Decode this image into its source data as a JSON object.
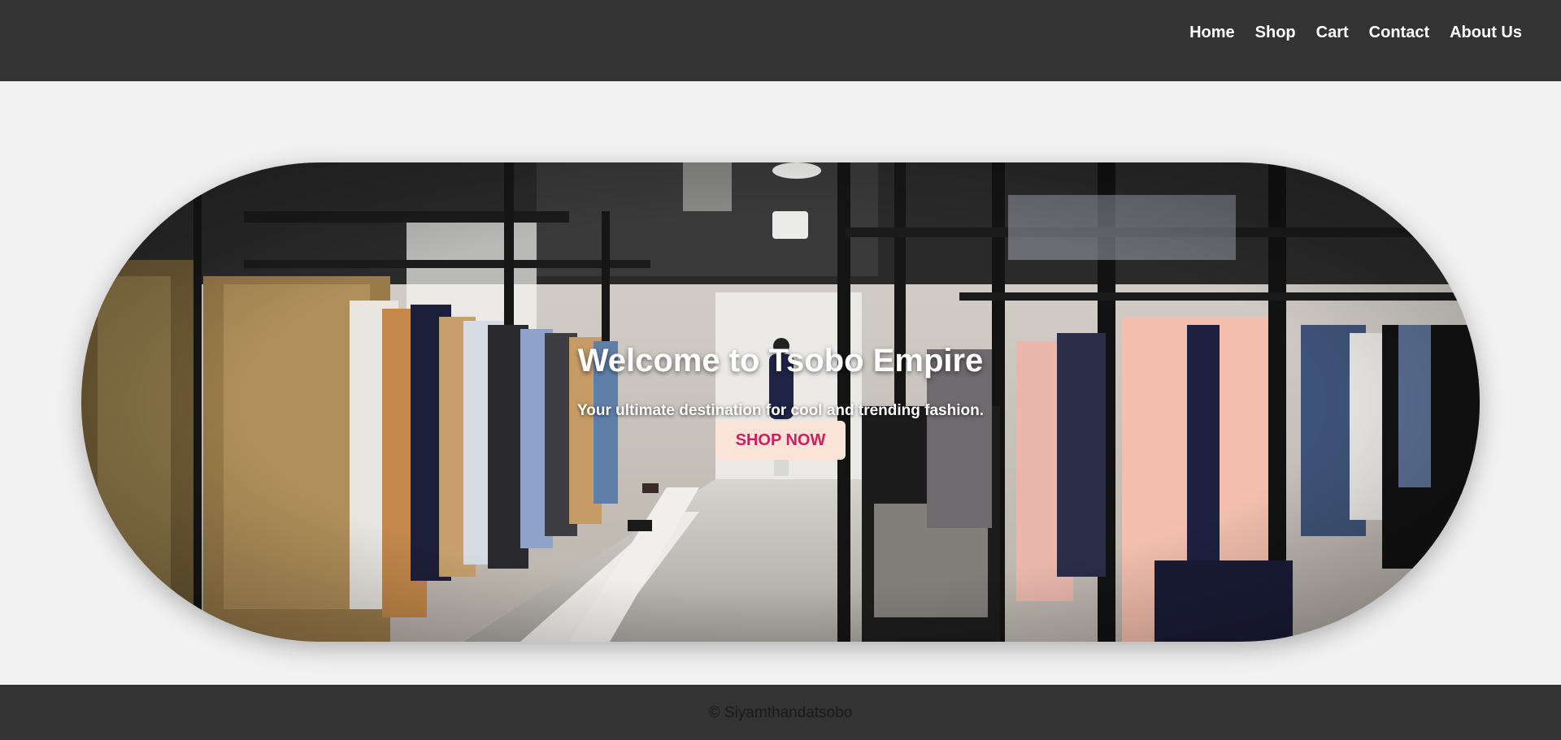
{
  "nav": {
    "items": [
      {
        "label": "Home"
      },
      {
        "label": "Shop"
      },
      {
        "label": "Cart"
      },
      {
        "label": "Contact"
      },
      {
        "label": "About Us"
      }
    ]
  },
  "hero": {
    "title": "Welcome to Tsobo Empire",
    "subtitle": "Your ultimate destination for cool and trending fashion.",
    "cta_label": "SHOP NOW"
  },
  "footer": {
    "copyright": "© Siyamthandatsobo"
  },
  "colors": {
    "nav_bg": "#333333",
    "page_bg": "#f2f2f2",
    "cta_bg": "#fbe3d8",
    "cta_text": "#cc1f5f"
  }
}
